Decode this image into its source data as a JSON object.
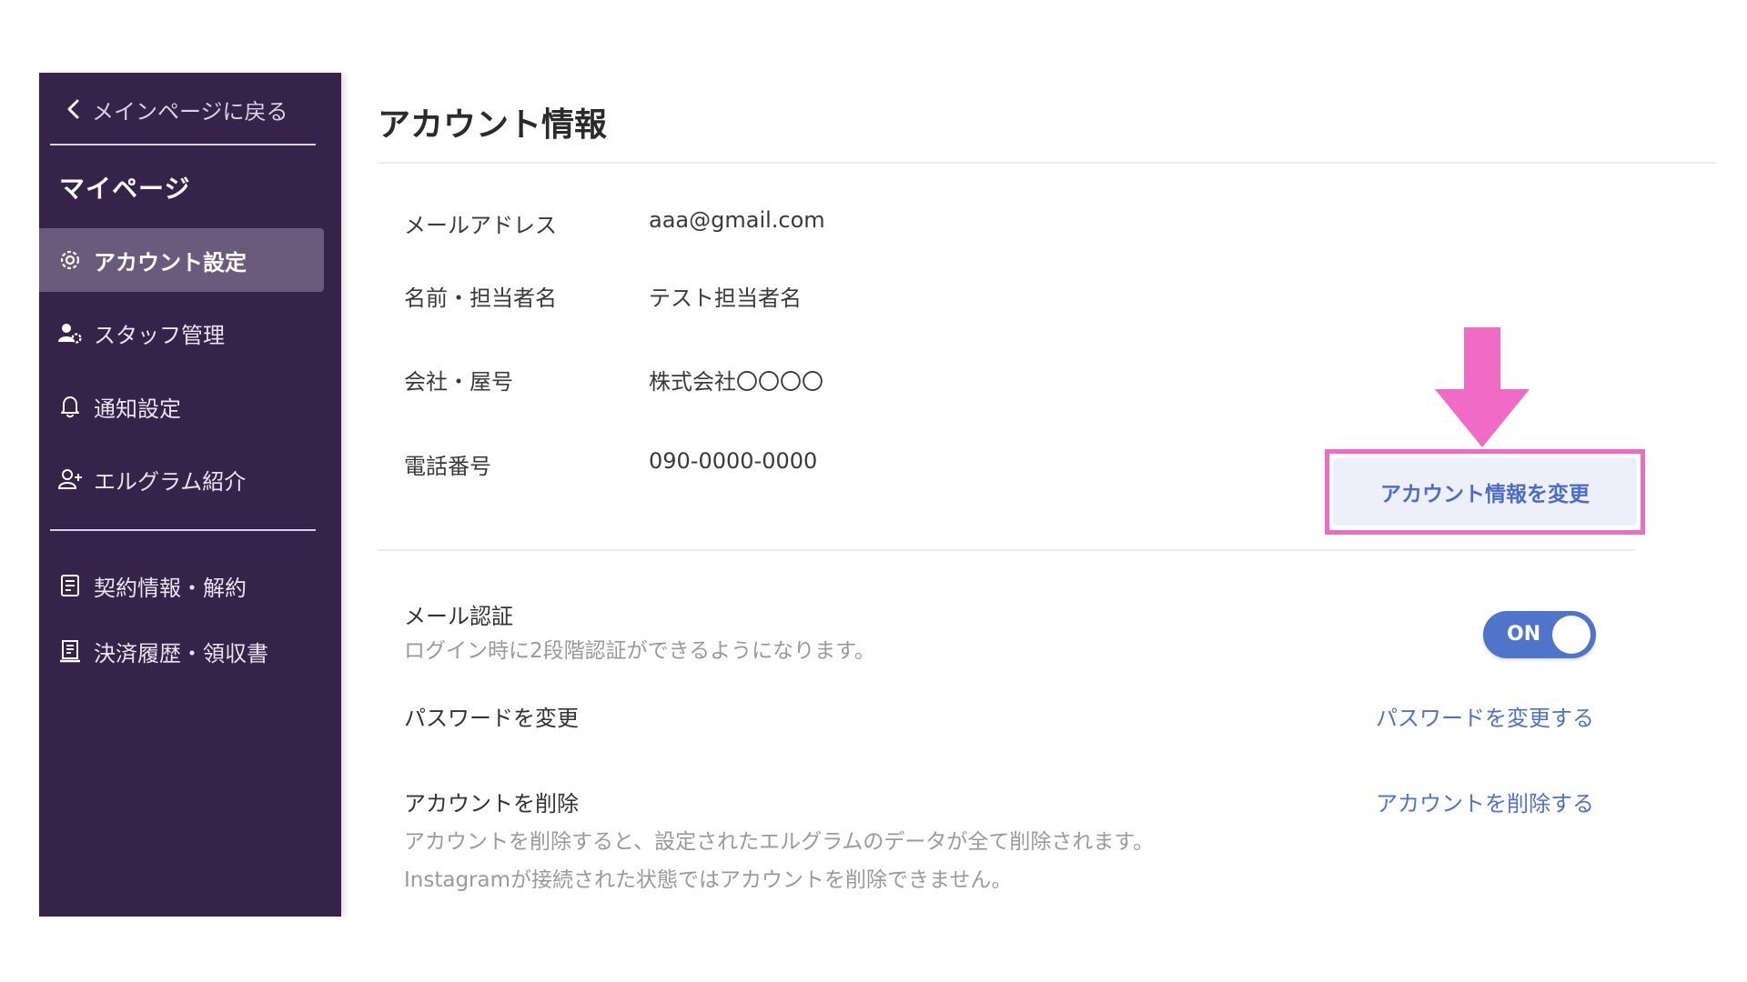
{
  "sidebar": {
    "back_label": "メインページに戻る",
    "section_title": "マイページ",
    "items": [
      {
        "label": "アカウント設定",
        "icon": "gear-icon",
        "active": true
      },
      {
        "label": "スタッフ管理",
        "icon": "staff-gear-icon",
        "active": false
      },
      {
        "label": "通知設定",
        "icon": "bell-icon",
        "active": false
      },
      {
        "label": "エルグラム紹介",
        "icon": "user-plus-icon",
        "active": false
      }
    ],
    "items2": [
      {
        "label": "契約情報・解約",
        "icon": "document-icon"
      },
      {
        "label": "決済履歴・領収書",
        "icon": "receipt-icon"
      }
    ]
  },
  "main": {
    "title": "アカウント情報",
    "info": [
      {
        "label": "メールアドレス",
        "value": "aaa@gmail.com"
      },
      {
        "label": "名前・担当者名",
        "value": "テスト担当者名"
      },
      {
        "label": "会社・屋号",
        "value": "株式会社〇〇〇〇"
      },
      {
        "label": "電話番号",
        "value": "090-0000-0000"
      }
    ],
    "edit_button": "アカウント情報を変更",
    "mail_auth": {
      "title": "メール認証",
      "desc": "ログイン時に2段階認証ができるようになります。",
      "toggle": "ON"
    },
    "password": {
      "title": "パスワードを変更",
      "link": "パスワードを変更する"
    },
    "delete": {
      "title": "アカウントを削除",
      "desc1": "アカウントを削除すると、設定されたエルグラムのデータが全て削除されます。",
      "desc2": "Instagramが接続された状態ではアカウントを削除できません。",
      "link": "アカウントを削除する"
    }
  },
  "colors": {
    "sidebar_bg": "#35234a",
    "active_item_bg": "#6a5a7c",
    "accent": "#4f74c9",
    "highlight": "#f06bc6"
  }
}
